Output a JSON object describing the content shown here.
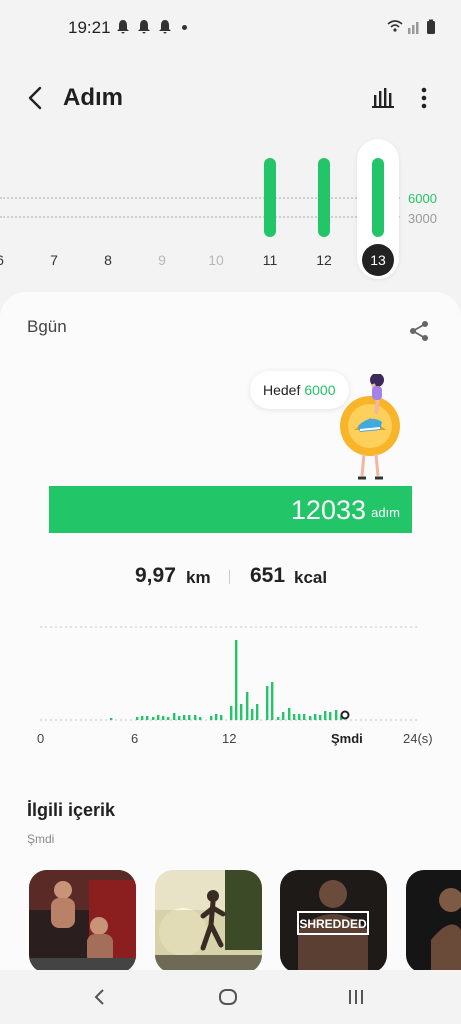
{
  "status_bar": {
    "time": "19:21"
  },
  "app_bar": {
    "title": "Adım"
  },
  "week_chart": {
    "goal_upper": "6000",
    "goal_lower": "3000",
    "days": [
      {
        "label": "6",
        "future": false
      },
      {
        "label": "7",
        "future": false
      },
      {
        "label": "8",
        "future": false
      },
      {
        "label": "9",
        "future": true
      },
      {
        "label": "10",
        "future": true
      },
      {
        "label": "11",
        "future": false
      },
      {
        "label": "12",
        "future": false
      },
      {
        "label": "13",
        "future": false,
        "selected": true
      }
    ]
  },
  "card": {
    "day_title": "Bgün",
    "goal_label": "Hedef",
    "goal_value": "6000",
    "steps": "12033",
    "steps_unit": "adım",
    "distance": "9,97",
    "distance_unit": "km",
    "calories": "651",
    "calories_unit": "kcal"
  },
  "hourly_chart": {
    "ticks": [
      "0",
      "6",
      "12",
      "Şmdi",
      "24(s)"
    ]
  },
  "related": {
    "title": "İlgili içerik",
    "subtitle": "Şmdi",
    "badge_text": "SHREDDED"
  },
  "colors": {
    "accent": "#22c567"
  }
}
